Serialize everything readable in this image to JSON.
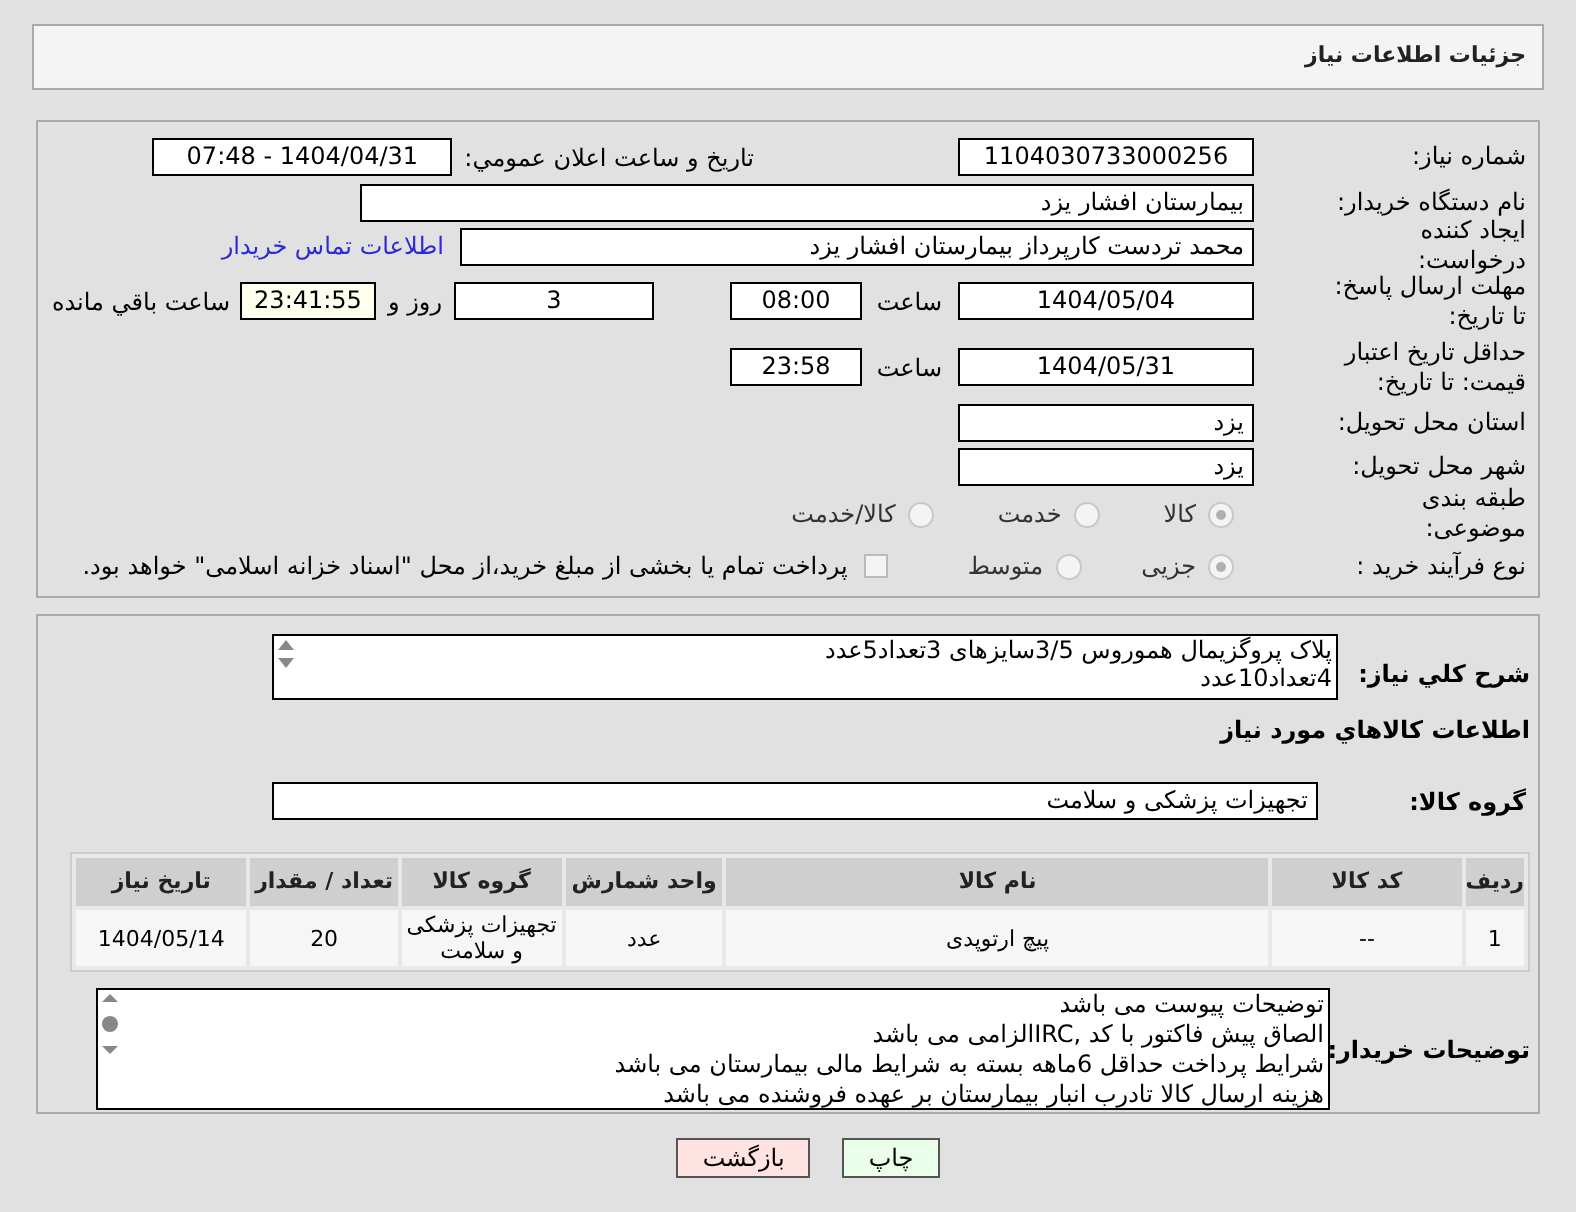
{
  "header": {
    "title": "جزئیات اطلاعات نیاز"
  },
  "need_number": {
    "label": "شماره نیاز:",
    "value": "1104030733000256"
  },
  "announce": {
    "label": "تاریخ و ساعت اعلان عمومي:",
    "value": "1404/04/31 - 07:48"
  },
  "buyer": {
    "label": "نام دستگاه خریدار:",
    "value": "بیمارستان افشار یزد"
  },
  "creator": {
    "label": "ایجاد کننده درخواست:",
    "value": "محمد تردست کارپرداز بیمارستان افشار یزد",
    "link": "اطلاعات تماس خریدار"
  },
  "deadline": {
    "label": "مهلت ارسال پاسخ: تا تاریخ:",
    "date": "1404/05/04",
    "time_label": "ساعت",
    "time": "08:00",
    "days": "3",
    "days_label": "روز و",
    "remaining": "23:41:55",
    "remaining_label": "ساعت باقي مانده"
  },
  "validity": {
    "label": "حداقل تاریخ اعتبار قیمت: تا تاریخ:",
    "date": "1404/05/31",
    "time_label": "ساعت",
    "time": "23:58"
  },
  "province": {
    "label": "استان محل تحویل:",
    "value": "یزد"
  },
  "city": {
    "label": "شهر محل تحویل:",
    "value": "یزد"
  },
  "category": {
    "label": "طبقه بندی موضوعی:",
    "options": [
      {
        "label": "کالا",
        "selected": true
      },
      {
        "label": "خدمت",
        "selected": false
      },
      {
        "label": "کالا/خدمت",
        "selected": false
      }
    ]
  },
  "process": {
    "label": "نوع فرآیند خرید :",
    "options": [
      {
        "label": "جزیی",
        "selected": true
      },
      {
        "label": "متوسط",
        "selected": false
      }
    ],
    "treasury": {
      "checked": false,
      "label": "پرداخت تمام یا بخشی از مبلغ خرید،از محل \"اسناد خزانه اسلامی\" خواهد بود."
    }
  },
  "description": {
    "label": "شرح کلي نياز:",
    "lines": [
      "پلاک پروگزیمال هموروس 3/5سایزهای 3تعداد5عدد",
      "4تعداد10عدد"
    ]
  },
  "goods_title": "اطلاعات کالاهاي مورد نياز",
  "goods_group": {
    "label": "گروه کالا:",
    "value": "تجهیزات پزشکی و سلامت"
  },
  "table": {
    "columns": [
      "ردیف",
      "کد کالا",
      "نام کالا",
      "واحد شمارش",
      "گروه کالا",
      "تعداد / مقدار",
      "تاریخ نیاز"
    ],
    "rows": [
      [
        "1",
        "--",
        "پیچ ارتوپدی",
        "عدد",
        "تجهیزات پزشکی و سلامت",
        "20",
        "1404/05/14"
      ]
    ]
  },
  "notes": {
    "label": "توضیحات خریدار:",
    "lines": [
      "توضیحات پیوست می باشد",
      "الصاق پیش فاکتور با کد  ,IRCالزامی می باشد",
      "شرایط پرداخت حداقل 6ماهه بسته به شرایط مالی بیمارستان می باشد",
      "هزینه ارسال کالا تادرب انبار بیمارستان بر عهدە فروشنده می باشد"
    ]
  },
  "buttons": [
    {
      "kind": "print",
      "label": "چاپ"
    },
    {
      "kind": "back",
      "label": "بازگشت"
    }
  ]
}
